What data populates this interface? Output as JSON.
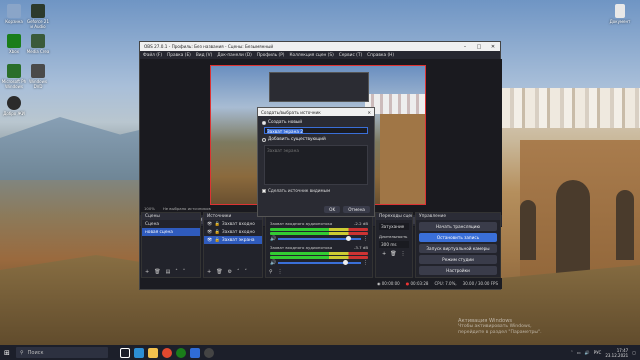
{
  "desktop": {
    "icons": [
      {
        "label": "Корзина",
        "color": "#8aa5c8"
      },
      {
        "label": "Geforce 21\nи Audio",
        "color": "#2c3a2c"
      },
      {
        "label": "Xbox",
        "color": "#1a7d1a"
      },
      {
        "label": "Media Crea",
        "color": "#3a5a3a"
      },
      {
        "label": "Microsoft Ph\nWindows",
        "color": "#2a6e2a"
      },
      {
        "label": "Windows\nDVD",
        "color": "#4a4a4a"
      },
      {
        "label": "Добро ЖИ",
        "color": "#2b2b2b"
      }
    ],
    "top_right_icon": "Документ",
    "watermark": [
      "Активация Windows",
      "Чтобы активировать Windows,",
      "перейдите в раздел \"Параметры\"."
    ]
  },
  "obs": {
    "title": "OBS 27.0.1 - Профиль: Без названия - Сцены: Безымянный",
    "menu": [
      "Файл (F)",
      "Правка (E)",
      "Вид (V)",
      "Док-панели (D)",
      "Профиль (P)",
      "Коллекция сцен (S)",
      "Сервис (T)",
      "Справка (H)"
    ],
    "status_line": [
      "100%",
      "Не выбрано источников"
    ],
    "toolbar": {
      "source_label": "Захват экрана",
      "properties": "Свойства",
      "filters": "Фильтры",
      "monitor": "1 монитор)"
    },
    "scenes": {
      "header": "Сцены",
      "items": [
        "Сцена",
        "новая сцена"
      ],
      "selected": 1
    },
    "sources": {
      "header": "Источники",
      "items": [
        "Захват входно",
        "Захват входно",
        "Захват экрана"
      ],
      "selected": 2
    },
    "mixer": {
      "tracks": [
        {
          "name": "Захват входного аудиопотока",
          "db": "-2.2 dB",
          "level": 0.82
        },
        {
          "name": "Захват входного аудиопотока",
          "db": "-3.7 dB",
          "level": 0.78
        }
      ]
    },
    "transitions": {
      "header": "Переходы сцен",
      "type": "Затухание",
      "duration_label": "Длительность",
      "duration": "300 ms"
    },
    "controls": {
      "header": "Управление",
      "buttons": [
        "Начать трансляцию",
        "Остановить запись",
        "Запуск виртуальной камеры",
        "Режим студии",
        "Настройки"
      ],
      "highlighted": 1
    },
    "statusbar": {
      "live": "00:00:00",
      "rec": "00:03:28",
      "cpu": "CPU: 7.0%,",
      "fps": "30.00 / 30.00 FPS"
    }
  },
  "dialog": {
    "title": "Создать/выбрать источник",
    "create_new": "Создать новый",
    "new_name": "Захват экрана 2",
    "add_existing": "Добавить существующий",
    "existing": [
      "Захват экрана"
    ],
    "make_visible": "Сделать источник видимым",
    "ok": "OK",
    "cancel": "Отмена"
  },
  "taskbar": {
    "search_placeholder": "Поиск",
    "apps": [
      {
        "name": "task-view",
        "color": "#ffffff"
      },
      {
        "name": "edge",
        "color": "#2d8fd5"
      },
      {
        "name": "explorer",
        "color": "#f2c14e"
      },
      {
        "name": "chrome",
        "color": "#e2492f"
      },
      {
        "name": "xbox",
        "color": "#1a7d1a"
      },
      {
        "name": "mail",
        "color": "#2f6cd6"
      },
      {
        "name": "obs",
        "color": "#444444"
      }
    ],
    "lang": "РУС",
    "time": "17:47",
    "date": "23.12.2021"
  }
}
